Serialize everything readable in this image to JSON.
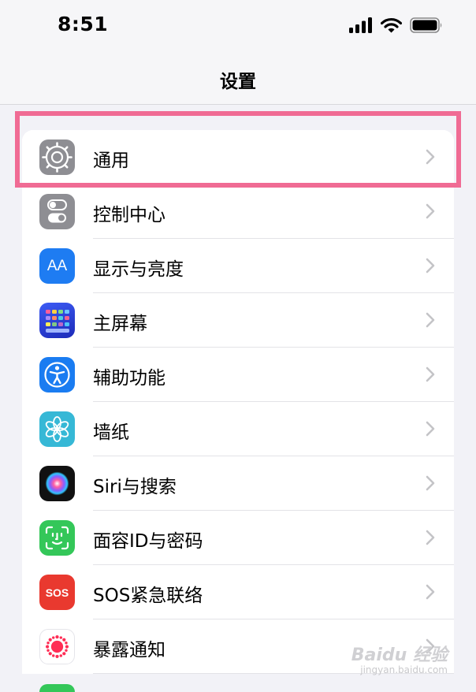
{
  "status_bar": {
    "time": "8:51"
  },
  "nav": {
    "title": "设置"
  },
  "settings": [
    {
      "label": "通用",
      "icon": "gear-icon",
      "color": "#8e8e93"
    },
    {
      "label": "控制中心",
      "icon": "toggles-icon",
      "color": "#8e8e93"
    },
    {
      "label": "显示与亮度",
      "icon": "text-size-icon",
      "color": "#1e7cf2"
    },
    {
      "label": "主屏幕",
      "icon": "home-grid-icon",
      "color": "#2f54eb"
    },
    {
      "label": "辅助功能",
      "icon": "accessibility-icon",
      "color": "#1a7cf1"
    },
    {
      "label": "墙纸",
      "icon": "flower-icon",
      "color": "#36b8d6"
    },
    {
      "label": "Siri与搜索",
      "icon": "siri-icon",
      "color": "#111111"
    },
    {
      "label": "面容ID与密码",
      "icon": "face-id-icon",
      "color": "#34c759"
    },
    {
      "label": "SOS紧急联络",
      "icon": "sos-icon",
      "color": "#e9392f"
    },
    {
      "label": "暴露通知",
      "icon": "exposure-icon",
      "color": "#ffffff"
    }
  ],
  "icon_text": {
    "display": "AA",
    "sos": "SOS"
  },
  "watermark": {
    "brand": "Baidu 经验",
    "url": "jingyan.baidu.com"
  }
}
